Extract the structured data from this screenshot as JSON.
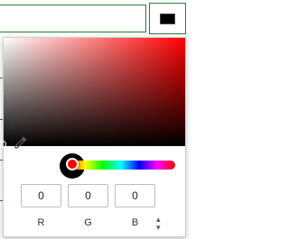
{
  "field": {
    "current_color_hex": "#000000"
  },
  "picker": {
    "hue_color": "#ff0000",
    "preview_color": "#000000",
    "channels": [
      {
        "key": "r",
        "value": "0",
        "label": "R"
      },
      {
        "key": "g",
        "value": "0",
        "label": "G"
      },
      {
        "key": "b",
        "value": "0",
        "label": "B"
      }
    ],
    "mode_toggle_icon": "chevron-up-down-icon",
    "eyedropper_icon": "eyedropper-icon"
  }
}
